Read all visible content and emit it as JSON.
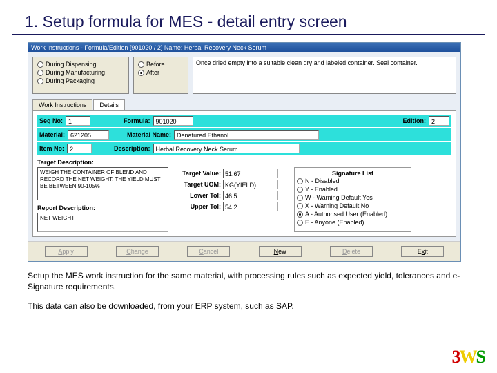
{
  "slide": {
    "title": "1. Setup formula for MES - detail entry screen",
    "caption1": "Setup the MES work instruction for the same material, with processing rules such as expected yield, tolerances and e-Signature requirements.",
    "caption2": "This data can also be downloaded, from your ERP system, such as SAP."
  },
  "logo": {
    "c1": "3",
    "c2": "W",
    "c3": "S"
  },
  "window": {
    "title": "Work Instructions - Formula/Edition [901020 / 2]   Name: Herbal Recovery Neck Serum",
    "phaseOptions": {
      "dispensing": "During Dispensing",
      "manufacturing": "During Manufacturing",
      "packaging": "During Packaging"
    },
    "baOptions": {
      "before": "Before",
      "after": "After"
    },
    "notes": "Once dried empty into a suitable clean dry and labeled container. Seal container.",
    "tabs": {
      "work": "Work Instructions",
      "details": "Details"
    },
    "rows": {
      "seqLabel": "Seq No:",
      "seq": "1",
      "formulaLabel": "Formula:",
      "formula": "901020",
      "editionLabel": "Edition:",
      "edition": "2",
      "materialLabel": "Material:",
      "material": "621205",
      "matNameLabel": "Material Name:",
      "matName": "Denatured Ethanol",
      "itemNoLabel": "Item No:",
      "itemNo": "2",
      "descLabel": "Description:",
      "desc": "Herbal Recovery Neck Serum"
    },
    "targetDesc": {
      "label": "Target Description:",
      "text": "WEIGH THE CONTAINER OF BLEND AND RECORD THE NET WEIGHT. THE YIELD MUST BE BETWEEN 90-105%"
    },
    "reportDesc": {
      "label": "Report Description:",
      "text": "NET WEIGHT"
    },
    "targets": {
      "valueLabel": "Target Value:",
      "value": "51.67",
      "uomLabel": "Target UOM:",
      "uom": "KG(YIELD)",
      "lowerLabel": "Lower Tol:",
      "lower": "46.5",
      "upperLabel": "Upper Tol:",
      "upper": "54.2"
    },
    "signature": {
      "groupLabel": "Signature List",
      "N": "N - Disabled",
      "Y": "Y - Enabled",
      "W": "W - Warning Default Yes",
      "X": "X - Warning Default No",
      "A": "A - Authorised User (Enabled)",
      "E": "E - Anyone (Enabled)"
    },
    "buttons": {
      "apply": "Apply",
      "change": "Change",
      "cancel": "Cancel",
      "new": "New",
      "delete": "Delete",
      "exit": "Exit"
    }
  }
}
